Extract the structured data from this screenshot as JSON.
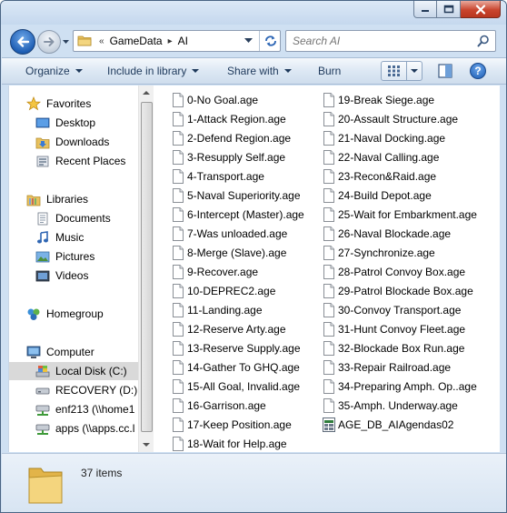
{
  "address": {
    "overflow": "«",
    "segments": [
      "GameData",
      "AI"
    ],
    "separator": "▸"
  },
  "search": {
    "placeholder": "Search AI"
  },
  "toolbar": {
    "organize": "Organize",
    "include_in_library": "Include in library",
    "share_with": "Share with",
    "burn": "Burn",
    "help": "?"
  },
  "navigation": {
    "favorites": "Favorites",
    "desktop": "Desktop",
    "downloads": "Downloads",
    "recent_places": "Recent Places",
    "libraries": "Libraries",
    "documents": "Documents",
    "music": "Music",
    "pictures": "Pictures",
    "videos": "Videos",
    "homegroup": "Homegroup",
    "computer": "Computer",
    "local_disk": "Local Disk (C:)",
    "recovery": "RECOVERY (D:)",
    "enf213": "enf213 (\\\\home1",
    "apps": "apps (\\\\apps.cc.l"
  },
  "files": [
    "0-No Goal.age",
    "1-Attack Region.age",
    "2-Defend Region.age",
    "3-Resupply Self.age",
    "4-Transport.age",
    "5-Naval Superiority.age",
    "6-Intercept (Master).age",
    "7-Was unloaded.age",
    "8-Merge (Slave).age",
    "9-Recover.age",
    "10-DEPREC2.age",
    "11-Landing.age",
    "12-Reserve Arty.age",
    "13-Reserve Supply.age",
    "14-Gather To GHQ.age",
    "15-All Goal, Invalid.age",
    "16-Garrison.age",
    "17-Keep Position.age",
    "18-Wait for Help.age",
    "19-Break Siege.age",
    "20-Assault Structure.age",
    "21-Naval Docking.age",
    "22-Naval Calling.age",
    "23-Recon&Raid.age",
    "24-Build Depot.age",
    "25-Wait for Embarkment.age",
    "26-Naval Blockade.age",
    "27-Synchronize.age",
    "28-Patrol Convoy Box.age",
    "29-Patrol Blockade Box.age",
    "30-Convoy Transport.age",
    "31-Hunt Convoy Fleet.age",
    "32-Blockade Box Run.age",
    "33-Repair Railroad.age",
    "34-Preparing Amph. Op..age",
    "35-Amph. Underway.age",
    "AGE_DB_AIAgendas02"
  ],
  "details": {
    "item_count": "37 items"
  },
  "colors": {
    "window_frame": "#cfe0f2",
    "toolbar_text": "#1e395b",
    "selection": "#d9d9d9",
    "close_button": "#c9452e"
  },
  "icons": {
    "file": "blank-file-icon",
    "special_file": "database-file-icon",
    "folder": "folder-icon"
  }
}
